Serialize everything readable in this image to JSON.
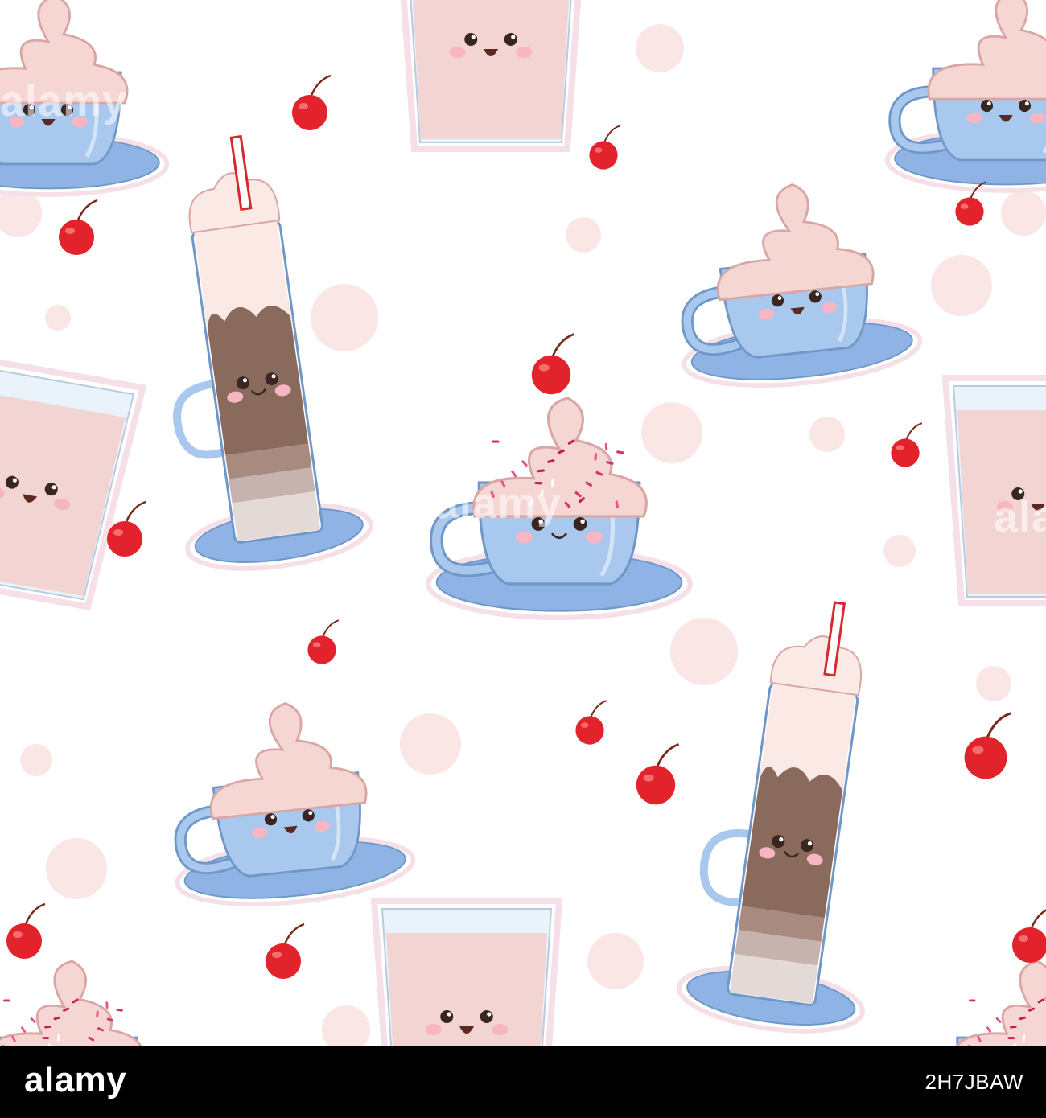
{
  "image": {
    "subject": "seamless pattern of kawaii drinks",
    "palette": {
      "background": "#ffffff",
      "dot": "#fbe6e6",
      "cup_blue": "#a9c8ee",
      "cup_blue_dark": "#6f98c9",
      "saucer": "#8fb3e4",
      "cream": "#f6d6d2",
      "cream_dark": "#d9a6a6",
      "chocolate": "#8a6a5c",
      "milk_pink": "#f2d4d2",
      "cherry": "#e3232b",
      "cheek": "#f7b6c2"
    }
  },
  "watermark": {
    "brand": "alamy"
  },
  "footer": {
    "logo": "alamy",
    "image_id": "2H7JBAW"
  }
}
